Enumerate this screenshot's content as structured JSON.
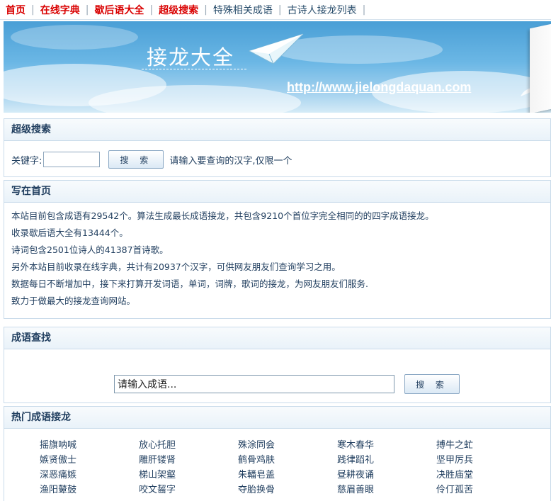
{
  "nav": {
    "items": [
      {
        "label": "首页",
        "highlight": true
      },
      {
        "label": "在线字典",
        "highlight": true
      },
      {
        "label": "歇后语大全",
        "highlight": true
      },
      {
        "label": "超级搜索",
        "highlight": true
      },
      {
        "label": "特殊相关成语",
        "highlight": false
      },
      {
        "label": "古诗人接龙列表",
        "highlight": false
      }
    ]
  },
  "banner": {
    "title": "接龙大全",
    "url": "http://www.jielongdaquan.com"
  },
  "super_search": {
    "heading": "超级搜索",
    "keyword_label": "关键字:",
    "keyword_value": "",
    "button_label": "搜 索",
    "hint": "请输入要查询的汉字,仅限一个"
  },
  "homepage": {
    "heading": "写在首页",
    "lines": [
      "本站目前包含成语有29542个。算法生成最长成语接龙，共包含9210个首位字完全相同的的四字成语接龙。",
      "收录歇后语大全有13444个。",
      "诗词包含2501位诗人的41387首诗歌。",
      "另外本站目前收录在线字典，共计有20937个汉字，可供网友朋友们查询学习之用。",
      "数据每日不断增加中，接下来打算开发词语，单词，词牌，歌词的接龙，为网友朋友们服务.",
      "致力于做最大的接龙查询网站。"
    ]
  },
  "idiom_search": {
    "heading": "成语查找",
    "input_value": "请输入成语...",
    "button_label": "搜 索"
  },
  "hot": {
    "heading": "热门成语接龙",
    "items": [
      "摇旗呐喊",
      "放心托胆",
      "殊涂同会",
      "寒木春华",
      "搏牛之虻",
      "嫉贤傲士",
      "雕肝镂肾",
      "鹤骨鸡肤",
      "践律蹈礼",
      "坚甲厉兵",
      "深恶痛嫉",
      "梯山架壑",
      "朱轓皂盖",
      "昼耕夜诵",
      "决胜庙堂",
      "渔阳鼙鼓",
      "咬文齧字",
      "夺胎换骨",
      "慈眉善眼",
      "伶仃孤苦"
    ]
  },
  "colors": {
    "nav_highlight": "#d90000",
    "text": "#1f3d5e",
    "panel_border": "#c9dbea",
    "banner_sky": "#4a9fd6"
  }
}
